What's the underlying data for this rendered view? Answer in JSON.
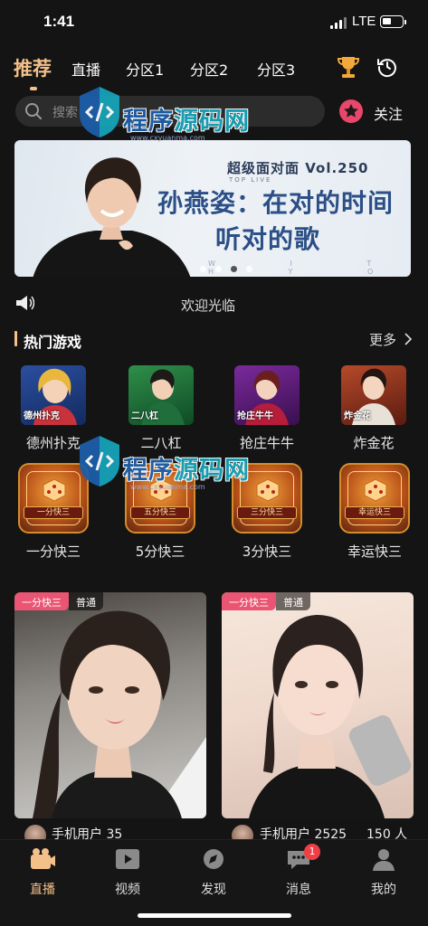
{
  "status_bar": {
    "time": "1:41",
    "network": "LTE"
  },
  "top_nav": {
    "tabs": [
      {
        "label": "推荐",
        "active": true
      },
      {
        "label": "直播"
      },
      {
        "label": "分区1"
      },
      {
        "label": "分区2"
      },
      {
        "label": "分区3"
      }
    ]
  },
  "search": {
    "placeholder": "搜索"
  },
  "follow": {
    "label": "关注"
  },
  "banner": {
    "show_name": "超级面对面 Vol.250",
    "show_sub": "TOP LIVE",
    "title_line1": "孙燕姿：在对的时间",
    "title_line2": "听对的歌",
    "footer": "W I T H   Y O U",
    "pages": 4,
    "active_page": 3
  },
  "notice": {
    "text": "欢迎光临"
  },
  "hot_games": {
    "title": "热门游戏",
    "more_label": "更多",
    "games": [
      {
        "label": "德州扑克",
        "tag": "德州扑克"
      },
      {
        "label": "二八杠",
        "tag": "二八杠"
      },
      {
        "label": "抢庄牛牛",
        "tag": "抢庄牛牛"
      },
      {
        "label": "炸金花",
        "tag": "炸金花"
      },
      {
        "label": "一分快三",
        "tag": "一分快三"
      },
      {
        "label": "5分快三",
        "tag": "五分快三"
      },
      {
        "label": "3分快三",
        "tag": "三分快三"
      },
      {
        "label": "幸运快三",
        "tag": "幸运快三"
      }
    ]
  },
  "live_cards": [
    {
      "game_tag": "一分快三",
      "level_tag": "普通",
      "user": "手机用户 35"
    },
    {
      "game_tag": "一分快三",
      "level_tag": "普通",
      "user": "手机用户 2525",
      "viewers": "150 人"
    }
  ],
  "watermark": {
    "brand_a": "程序",
    "brand_b": "源码网",
    "url": "www.cxyuanma.com"
  },
  "tab_bar": {
    "tabs": [
      {
        "label": "直播",
        "icon": "live-icon",
        "active": true
      },
      {
        "label": "视频",
        "icon": "video-icon"
      },
      {
        "label": "发现",
        "icon": "discover-icon"
      },
      {
        "label": "消息",
        "icon": "message-icon",
        "badge": "1"
      },
      {
        "label": "我的",
        "icon": "profile-icon"
      }
    ]
  },
  "colors": {
    "accent": "#f4c08a",
    "background": "#141414",
    "pink": "#e95573",
    "badge_red": "#ef3e45"
  }
}
